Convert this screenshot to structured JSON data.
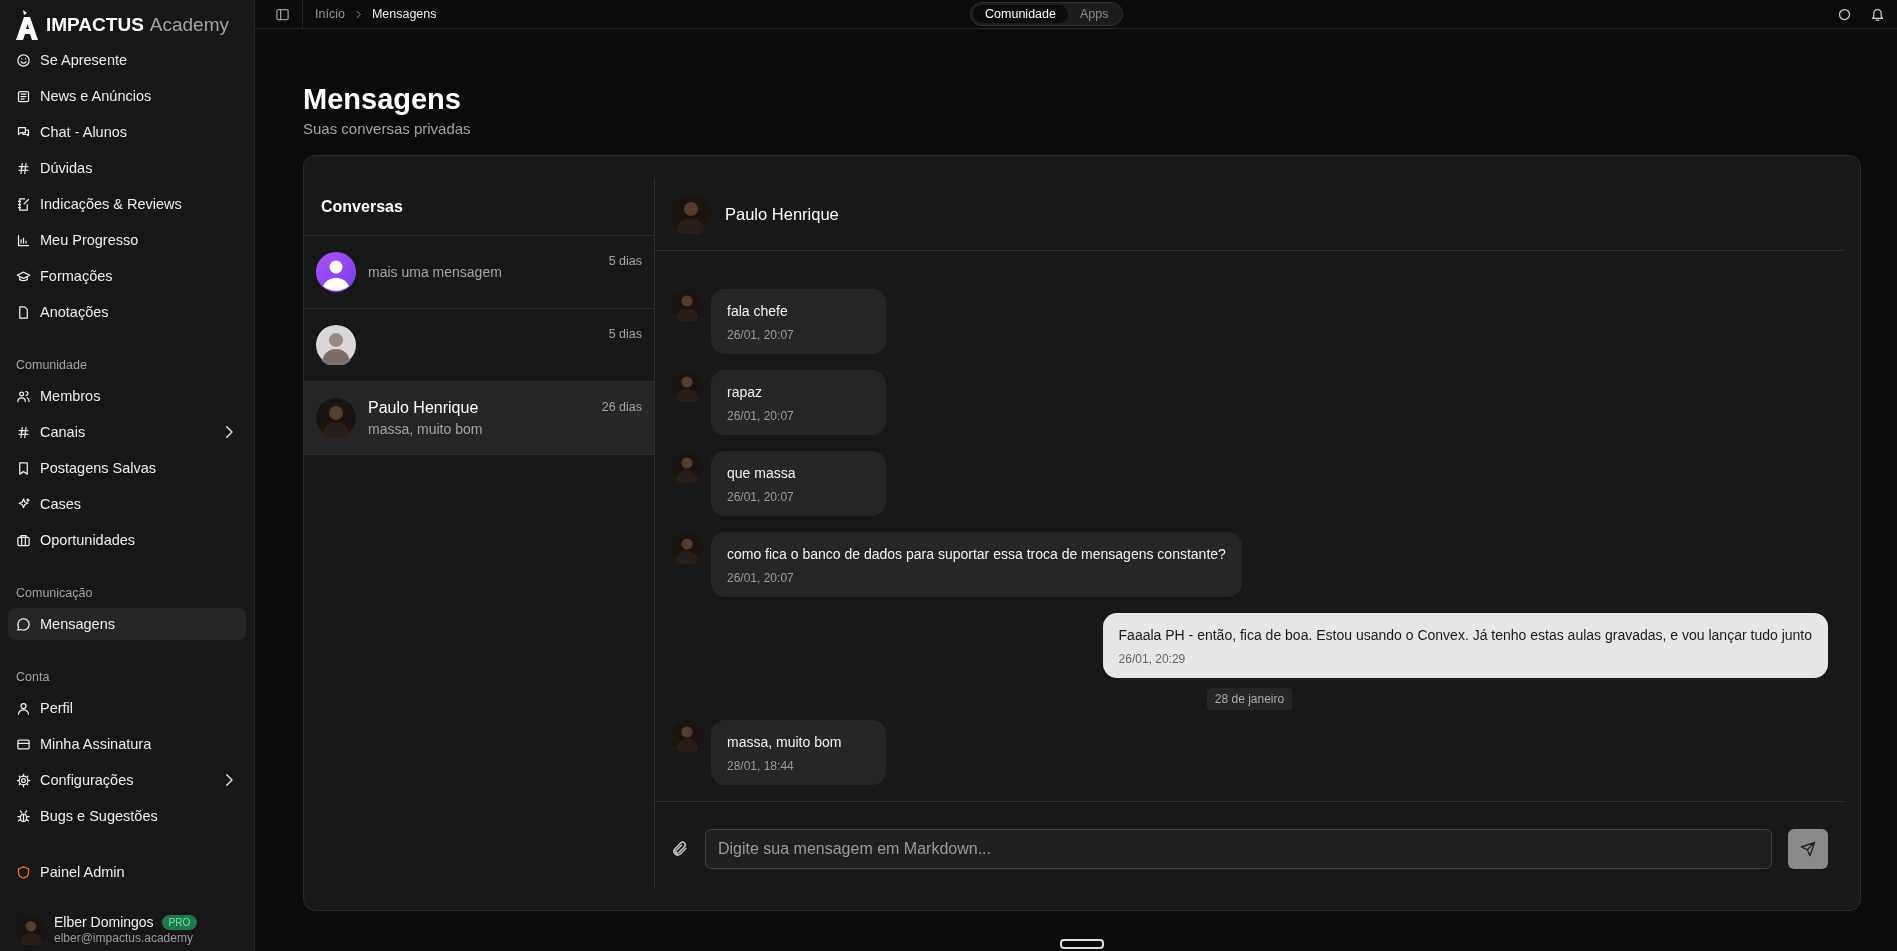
{
  "brand": {
    "name": "IMPACTUS",
    "suffix": "Academy"
  },
  "sidebar": {
    "sections": [
      {
        "items": [
          {
            "label": "Se Apresente",
            "selected": false,
            "submenu": false
          },
          {
            "label": "News e Anúncios",
            "selected": false,
            "submenu": false
          },
          {
            "label": "Chat - Alunos",
            "selected": false,
            "submenu": false
          },
          {
            "label": "Dúvidas",
            "selected": false,
            "submenu": false
          },
          {
            "label": "Indicações & Reviews",
            "selected": false,
            "submenu": false
          },
          {
            "label": "Meu Progresso",
            "selected": false,
            "submenu": false
          },
          {
            "label": "Formações",
            "selected": false,
            "submenu": false
          },
          {
            "label": "Anotações",
            "selected": false,
            "submenu": false
          }
        ]
      },
      {
        "title": "Comunidade",
        "items": [
          {
            "label": "Membros",
            "selected": false,
            "submenu": false
          },
          {
            "label": "Canais",
            "selected": false,
            "submenu": true
          },
          {
            "label": "Postagens Salvas",
            "selected": false,
            "submenu": false
          },
          {
            "label": "Cases",
            "selected": false,
            "submenu": false
          },
          {
            "label": "Oportunidades",
            "selected": false,
            "submenu": false
          }
        ]
      },
      {
        "title": "Comunicação",
        "items": [
          {
            "label": "Mensagens",
            "selected": true,
            "submenu": false
          }
        ]
      },
      {
        "title": "Conta",
        "items": [
          {
            "label": "Perfil",
            "selected": false,
            "submenu": false
          },
          {
            "label": "Minha Assinatura",
            "selected": false,
            "submenu": false
          },
          {
            "label": "Configurações",
            "selected": false,
            "submenu": true
          },
          {
            "label": "Bugs e Sugestões",
            "selected": false,
            "submenu": false
          }
        ]
      },
      {
        "items": [
          {
            "label": "Painel Admin",
            "selected": false,
            "submenu": false
          }
        ]
      }
    ],
    "user": {
      "name": "Elber Domingos",
      "badge": "PRO",
      "email": "elber@impactus.academy"
    }
  },
  "topbar": {
    "breadcrumbs": [
      "Início",
      "Mensagens"
    ],
    "tabs": [
      {
        "label": "Comunidade",
        "selected": true
      },
      {
        "label": "Apps",
        "selected": false
      }
    ]
  },
  "page": {
    "title": "Mensagens",
    "subtitle": "Suas conversas privadas"
  },
  "conversations": {
    "title": "Conversas",
    "items": [
      {
        "photo": false,
        "time": "5 dias",
        "preview": "mais uma mensagem",
        "selected": false
      },
      {
        "photo": true,
        "time": "5 dias",
        "selected": false
      },
      {
        "photo": true,
        "name": "Paulo Henrique",
        "time": "26 dias",
        "preview": "massa, muito bom",
        "selected": true
      }
    ]
  },
  "chat": {
    "contact": "Paulo Henrique",
    "messages": [
      {
        "kind": "message",
        "outgoing": false,
        "text": "fala chefe",
        "time": "26/01, 20:07"
      },
      {
        "kind": "message",
        "outgoing": false,
        "text": "rapaz",
        "time": "26/01, 20:07"
      },
      {
        "kind": "message",
        "outgoing": false,
        "text": "que massa",
        "time": "26/01, 20:07"
      },
      {
        "kind": "message",
        "outgoing": false,
        "text": "como fica o banco de dados para suportar essa troca de mensagens constante?",
        "time": "26/01, 20:07"
      },
      {
        "kind": "message",
        "outgoing": true,
        "text": "Faaala PH - então, fica de boa. Estou usando o Convex. Já tenho estas aulas gravadas, e vou lançar tudo junto",
        "time": "26/01, 20:29"
      },
      {
        "kind": "date",
        "text": "28 de janeiro"
      },
      {
        "kind": "message",
        "outgoing": false,
        "text": "massa, muito bom",
        "time": "28/01, 18:44"
      }
    ],
    "input": {
      "placeholder": "Digite sua mensagem em Markdown..."
    }
  }
}
